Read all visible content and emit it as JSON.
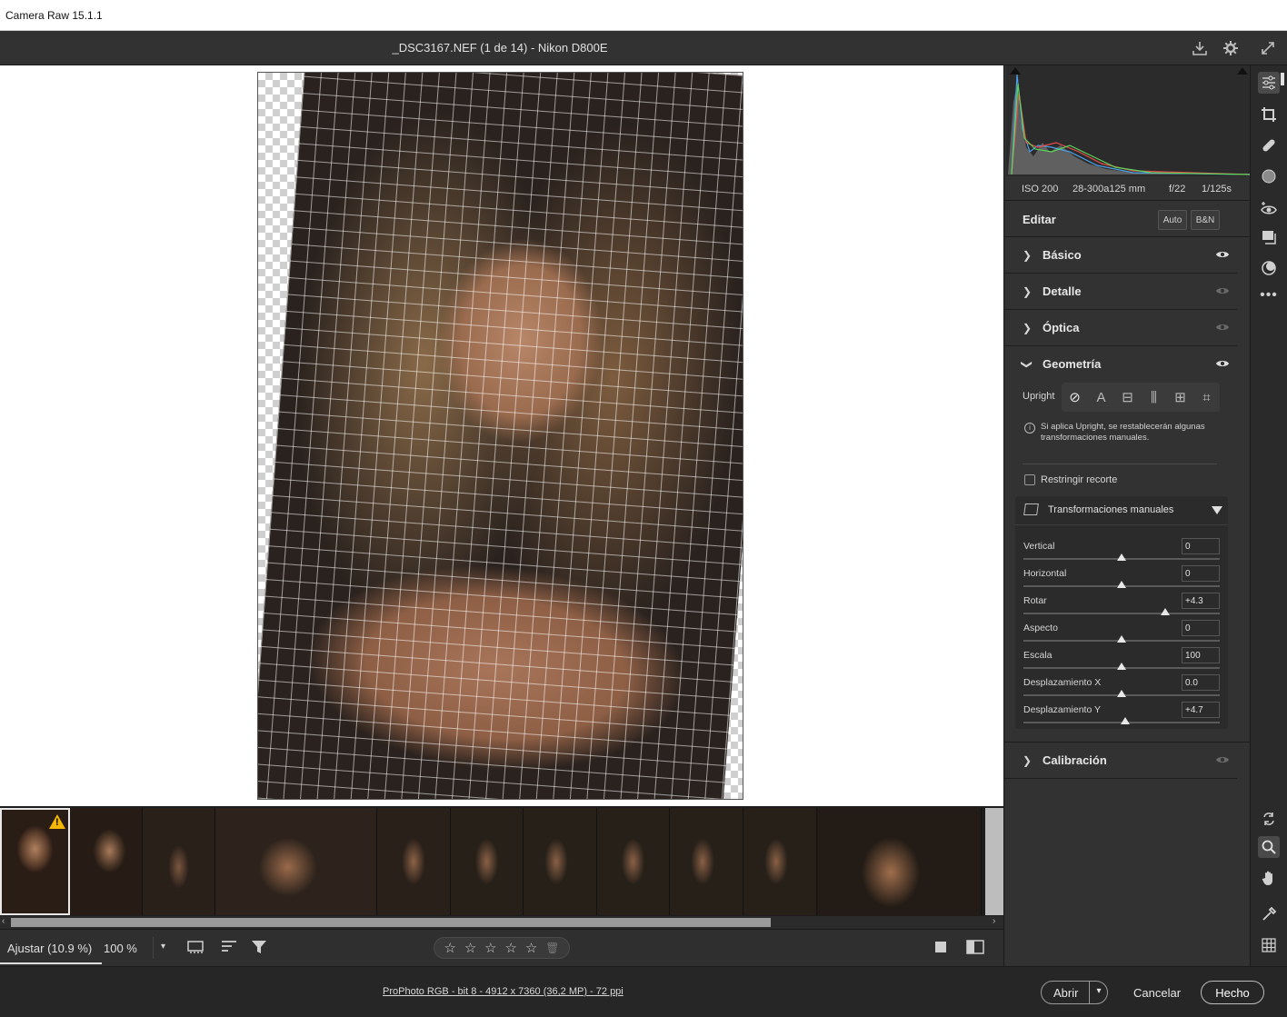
{
  "window": {
    "title": "Camera Raw 15.1.1"
  },
  "header": {
    "file_title": "_DSC3167.NEF (1 de 14) -  Nikon D800E"
  },
  "exif": {
    "iso": "ISO 200",
    "lens": "28-300a125 mm",
    "aperture": "f/22",
    "shutter": "1/125s"
  },
  "edit": {
    "title": "Editar",
    "auto_label": "Auto",
    "bw_label": "B&N"
  },
  "sections": {
    "basic": "Básico",
    "detail": "Detalle",
    "optics": "Óptica",
    "geometry": "Geometría",
    "calibration": "Calibración"
  },
  "geometry": {
    "upright_label": "Upright",
    "upright_note": "Si aplica Upright, se restablecerán algunas transformaciones manuales.",
    "constrain_crop_label": "Restringir recorte",
    "manual_title": "Transformaciones manuales",
    "sliders": [
      {
        "label": "Vertical",
        "value": "0",
        "position": 0.5
      },
      {
        "label": "Horizontal",
        "value": "0",
        "position": 0.5
      },
      {
        "label": "Rotar",
        "value": "+4.3",
        "position": 0.72
      },
      {
        "label": "Aspecto",
        "value": "0",
        "position": 0.5
      },
      {
        "label": "Escala",
        "value": "100",
        "position": 0.5
      },
      {
        "label": "Desplazamiento X",
        "value": "0.0",
        "position": 0.5
      },
      {
        "label": "Desplazamiento Y",
        "value": "+4.7",
        "position": 0.52
      }
    ]
  },
  "toolbar": {
    "zoom_fit": "Ajustar (10.9 %)",
    "zoom_100": "100 %"
  },
  "footer": {
    "workflow": "ProPhoto RGB - bit 8 - 4912 x 7360 (36,2 MP) - 72 ppi",
    "open_label": "Abrir",
    "cancel_label": "Cancelar",
    "done_label": "Hecho"
  },
  "filmstrip": {
    "count": 14
  },
  "colors": {
    "accent": "#e8e8e8",
    "warning": "#f2b705",
    "panel": "#323232"
  }
}
